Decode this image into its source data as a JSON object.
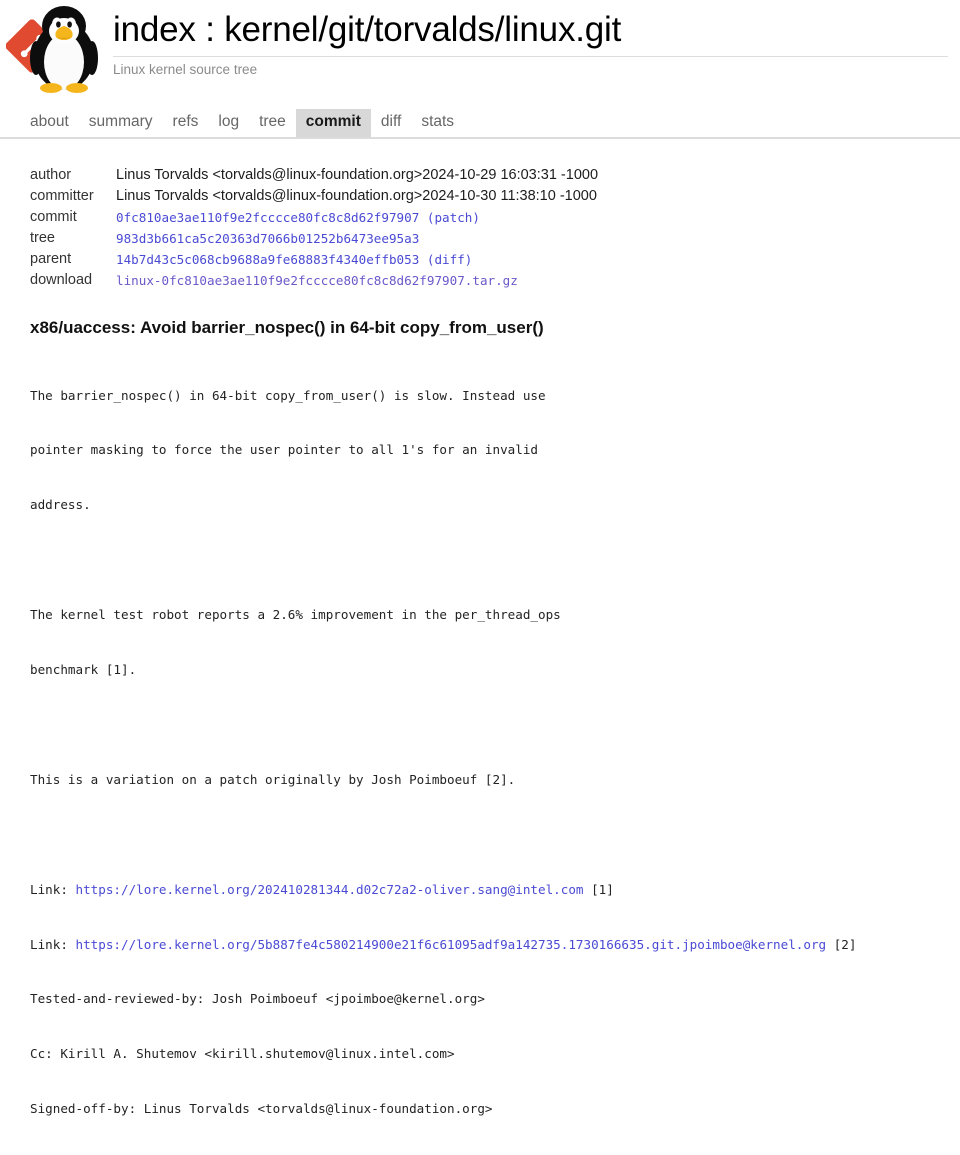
{
  "header": {
    "logo_name": "tux-git-logo",
    "title_prefix": "index : ",
    "title_repo": "kernel/git/torvalds/linux.git",
    "title_full": "index : kernel/git/torvalds/linux.git",
    "subtitle": "Linux kernel source tree"
  },
  "tabs": [
    {
      "label": "about",
      "active": false
    },
    {
      "label": "summary",
      "active": false
    },
    {
      "label": "refs",
      "active": false
    },
    {
      "label": "log",
      "active": false
    },
    {
      "label": "tree",
      "active": false
    },
    {
      "label": "commit",
      "active": true
    },
    {
      "label": "diff",
      "active": false
    },
    {
      "label": "stats",
      "active": false
    }
  ],
  "commit_info": {
    "labels": {
      "author": "author",
      "committer": "committer",
      "commit": "commit",
      "tree": "tree",
      "parent": "parent",
      "download": "download"
    },
    "author": {
      "person": "Linus Torvalds <torvalds@linux-foundation.org>",
      "date": "2024-10-29 16:03:31 -1000"
    },
    "committer": {
      "person": "Linus Torvalds <torvalds@linux-foundation.org>",
      "date": "2024-10-30 11:38:10 -1000"
    },
    "commit": {
      "sha": "0fc810ae3ae110f9e2fcccce80fc8c8d62f97907",
      "extra": "(patch)"
    },
    "tree": {
      "sha": "983d3b661ca5c20363d7066b01252b6473ee95a3"
    },
    "parent": {
      "sha": "14b7d43c5c068cb9688a9fe68883f4340effb053",
      "extra": "(diff)"
    },
    "download": {
      "file": "linux-0fc810ae3ae110f9e2fcccce80fc8c8d62f97907.tar.gz"
    }
  },
  "commit_message": {
    "subject": "x86/uaccess: Avoid barrier_nospec() in 64-bit copy_from_user()",
    "body_lines": [
      "The barrier_nospec() in 64-bit copy_from_user() is slow. Instead use",
      "pointer masking to force the user pointer to all 1's for an invalid",
      "address.",
      "",
      "The kernel test robot reports a 2.6% improvement in the per_thread_ops",
      "benchmark [1].",
      "",
      "This is a variation on a patch originally by Josh Poimboeuf [2].",
      ""
    ],
    "link1": {
      "prefix": "Link: ",
      "url": "https://lore.kernel.org/202410281344.d02c72a2-oliver.sang@intel.com",
      "suffix": " [1]"
    },
    "link2": {
      "prefix": "Link: ",
      "url": "https://lore.kernel.org/5b887fe4c580214900e21f6c61095adf9a142735.1730166635.git.jpoimboe@kernel.org",
      "suffix": " [2]"
    },
    "trailer_lines": [
      "Tested-and-reviewed-by: Josh Poimboeuf <jpoimboe@kernel.org>",
      "Cc: Kirill A. Shutemov <kirill.shutemov@linux.intel.com>",
      "Signed-off-by: Linus Torvalds <torvalds@linux-foundation.org>"
    ]
  },
  "colors": {
    "link": "#4a4ad4",
    "visited_link": "#6b58c9",
    "tab_active_bg": "#d8d8d8",
    "tab_text": "#666666",
    "subtitle": "#8b8b8b",
    "rule": "#dcdcdc"
  }
}
